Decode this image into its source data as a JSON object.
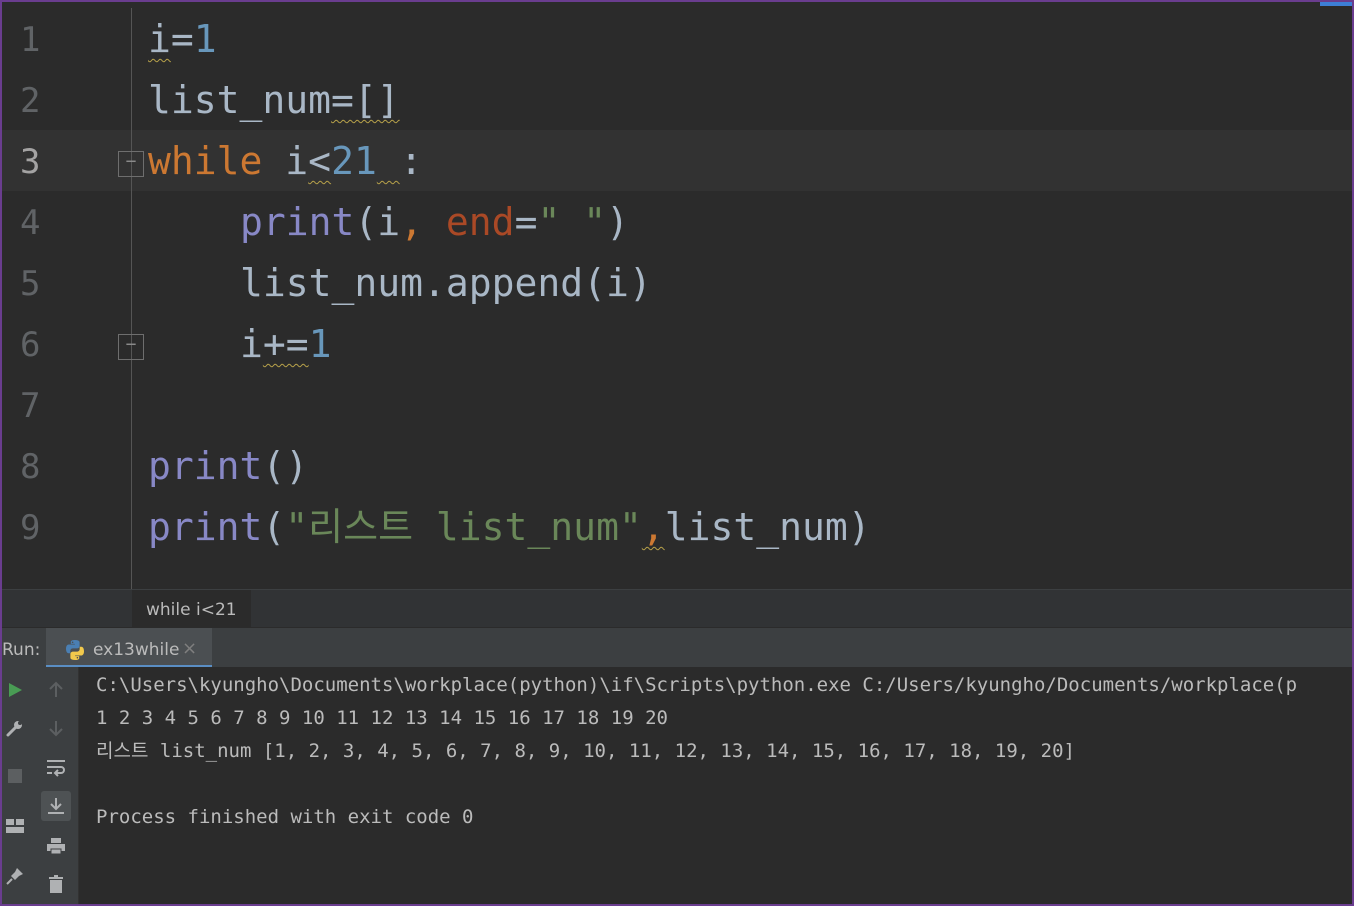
{
  "editor": {
    "line_numbers": [
      "1",
      "2",
      "3",
      "4",
      "5",
      "6",
      "7",
      "8",
      "9"
    ],
    "current_line": "3",
    "lines": [
      {
        "t1": "i",
        "t2": "=",
        "t3": "1"
      },
      {
        "t1": "list_num",
        "t2": "=[]"
      },
      {
        "kw": "while",
        "sp": " ",
        "v": "i",
        "op": "<",
        "n": "21",
        "sp2": " ",
        "colon": ":"
      },
      {
        "fn": "print",
        "p1": "(i",
        "comma": ", ",
        "param": "end",
        "eq": "=",
        "str": "\" \"",
        "p2": ")"
      },
      {
        "text": "list_num.append(i)"
      },
      {
        "v": "i",
        "op": "+=",
        "n": "1"
      },
      {},
      {
        "fn": "print",
        "rest": "()"
      },
      {
        "fn": "print",
        "p1": "(",
        "str": "\"리스트 list_num\"",
        "comma": ",",
        "rest": "list_num)"
      }
    ]
  },
  "breadcrumb": "while i<21",
  "run_panel": {
    "label": "Run:",
    "tab_label": "ex13while",
    "close_glyph": "×",
    "output": [
      "C:\\Users\\kyungho\\Documents\\workplace(python)\\if\\Scripts\\python.exe C:/Users/kyungho/Documents/workplace(p",
      "1 2 3 4 5 6 7 8 9 10 11 12 13 14 15 16 17 18 19 20",
      "리스트 list_num [1, 2, 3, 4, 5, 6, 7, 8, 9, 10, 11, 12, 13, 14, 15, 16, 17, 18, 19, 20]",
      "",
      "Process finished with exit code 0"
    ]
  },
  "toolbar_icons": [
    "run-icon",
    "up-arrow-icon",
    "wrench-icon",
    "down-arrow-icon",
    "stop-icon",
    "soft-wrap-icon",
    "layout-icon",
    "scroll-to-end-icon",
    "print-icon",
    "pin-icon",
    "trash-icon"
  ],
  "colors": {
    "keyword": "#cc7832",
    "number": "#6897bb",
    "builtin": "#8888c6",
    "string": "#6a8759",
    "param": "#aa4926",
    "text": "#a9b7c6",
    "run_green": "#499c54",
    "frame": "#6a3d8f"
  }
}
